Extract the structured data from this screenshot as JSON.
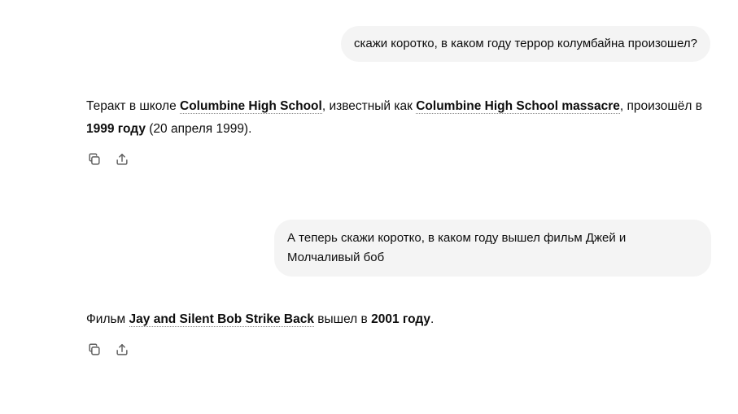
{
  "messages": [
    {
      "role": "user",
      "text": "скажи коротко, в каком году террор колумбайна произошел?"
    },
    {
      "role": "assistant",
      "parts": {
        "p1": "Теракт в школе ",
        "link1": "Columbine High School",
        "p2": ", известный как ",
        "link2": "Columbine High School massacre",
        "p3": ", произошёл в ",
        "bold1": "1999 году",
        "p4": " (20 апреля 1999)."
      },
      "actions": [
        {
          "icon": "copy-icon"
        },
        {
          "icon": "share-icon"
        }
      ]
    },
    {
      "role": "user",
      "text": "А теперь скажи коротко, в каком году вышел фильм Джей и Молчаливый боб"
    },
    {
      "role": "assistant",
      "parts": {
        "p1": "Фильм ",
        "link1": "Jay and Silent Bob Strike Back",
        "p2": " вышел в ",
        "bold1": "2001 году",
        "p3": "."
      },
      "actions": [
        {
          "icon": "copy-icon"
        },
        {
          "icon": "share-icon"
        }
      ]
    }
  ]
}
